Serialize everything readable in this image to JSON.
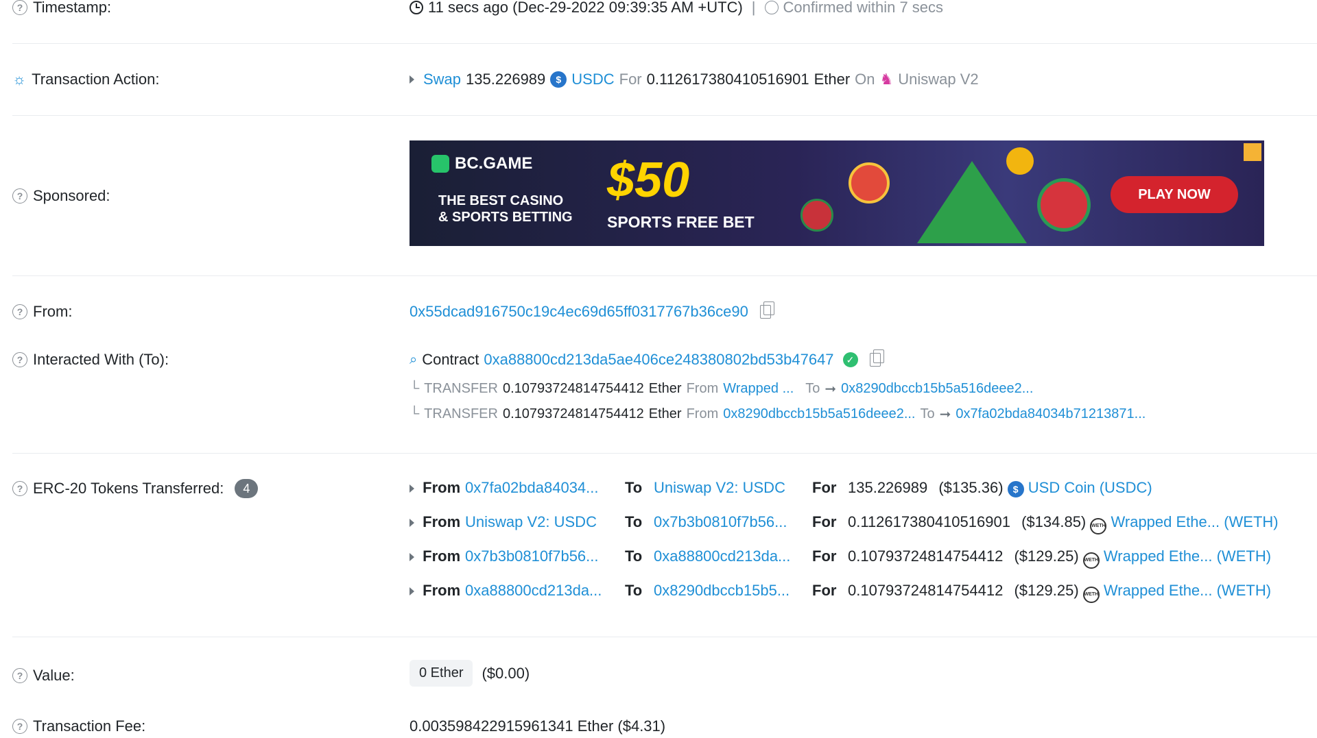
{
  "timestamp": {
    "label": "Timestamp:",
    "value": "11 secs ago (Dec-29-2022 09:39:35 AM +UTC)",
    "separator": "|",
    "confirmed": "Confirmed within 7 secs"
  },
  "transaction_action": {
    "label": "Transaction Action:",
    "verb": "Swap",
    "amount": "135.226989",
    "token": "USDC",
    "for_word": "For",
    "for_amount": "0.112617380410516901",
    "for_unit": "Ether",
    "on_word": "On",
    "dex": "Uniswap V2"
  },
  "sponsored": {
    "label": "Sponsored:",
    "brand": "BC.GAME",
    "tagline_1": "THE BEST CASINO",
    "tagline_2": "& SPORTS BETTING",
    "amount": "$50",
    "subtitle": "SPORTS FREE BET",
    "cta": "PLAY NOW"
  },
  "from": {
    "label": "From:",
    "address": "0x55dcad916750c19c4ec69d65ff0317767b36ce90"
  },
  "interacted": {
    "label": "Interacted With (To):",
    "contract_word": "Contract",
    "address": "0xa88800cd213da5ae406ce248380802bd53b47647",
    "transfers": [
      {
        "kind": "TRANSFER",
        "amount": "0.10793724814754412",
        "unit": "Ether",
        "from_word": "From",
        "from": "Wrapped ...",
        "to_word": "To",
        "to": "0x8290dbccb15b5a516deee2..."
      },
      {
        "kind": "TRANSFER",
        "amount": "0.10793724814754412",
        "unit": "Ether",
        "from_word": "From",
        "from": "0x8290dbccb15b5a516deee2...",
        "to_word": "To",
        "to": "0x7fa02bda84034b71213871..."
      }
    ]
  },
  "erc20": {
    "label": "ERC-20 Tokens Transferred:",
    "count": "4",
    "rows": [
      {
        "from_word": "From",
        "from": "0x7fa02bda84034...",
        "to_word": "To",
        "to": "Uniswap V2: USDC",
        "for_word": "For",
        "amount": "135.226989",
        "usd": "($135.36)",
        "token": "USD Coin (USDC)",
        "icon": "usdc-coin-icon"
      },
      {
        "from_word": "From",
        "from": "Uniswap V2: USDC",
        "to_word": "To",
        "to": "0x7b3b0810f7b56...",
        "for_word": "For",
        "amount": "0.112617380410516901",
        "usd": "($134.85)",
        "token": "Wrapped Ethe... (WETH)",
        "icon": "weth-coin-icon"
      },
      {
        "from_word": "From",
        "from": "0x7b3b0810f7b56...",
        "to_word": "To",
        "to": "0xa88800cd213da...",
        "for_word": "For",
        "amount": "0.10793724814754412",
        "usd": "($129.25)",
        "token": "Wrapped Ethe... (WETH)",
        "icon": "weth-coin-icon"
      },
      {
        "from_word": "From",
        "from": "0xa88800cd213da...",
        "to_word": "To",
        "to": "0x8290dbccb15b5...",
        "for_word": "For",
        "amount": "0.10793724814754412",
        "usd": "($129.25)",
        "token": "Wrapped Ethe... (WETH)",
        "icon": "weth-coin-icon"
      }
    ]
  },
  "value": {
    "label": "Value:",
    "amount": "0 Ether",
    "usd": "($0.00)"
  },
  "fee": {
    "label": "Transaction Fee:",
    "value": "0.003598422915961341 Ether ($4.31)"
  },
  "colors": {
    "link": "#1f8fd6",
    "muted": "#8a9199",
    "badge": "#6c757d",
    "check": "#2fbf71"
  }
}
